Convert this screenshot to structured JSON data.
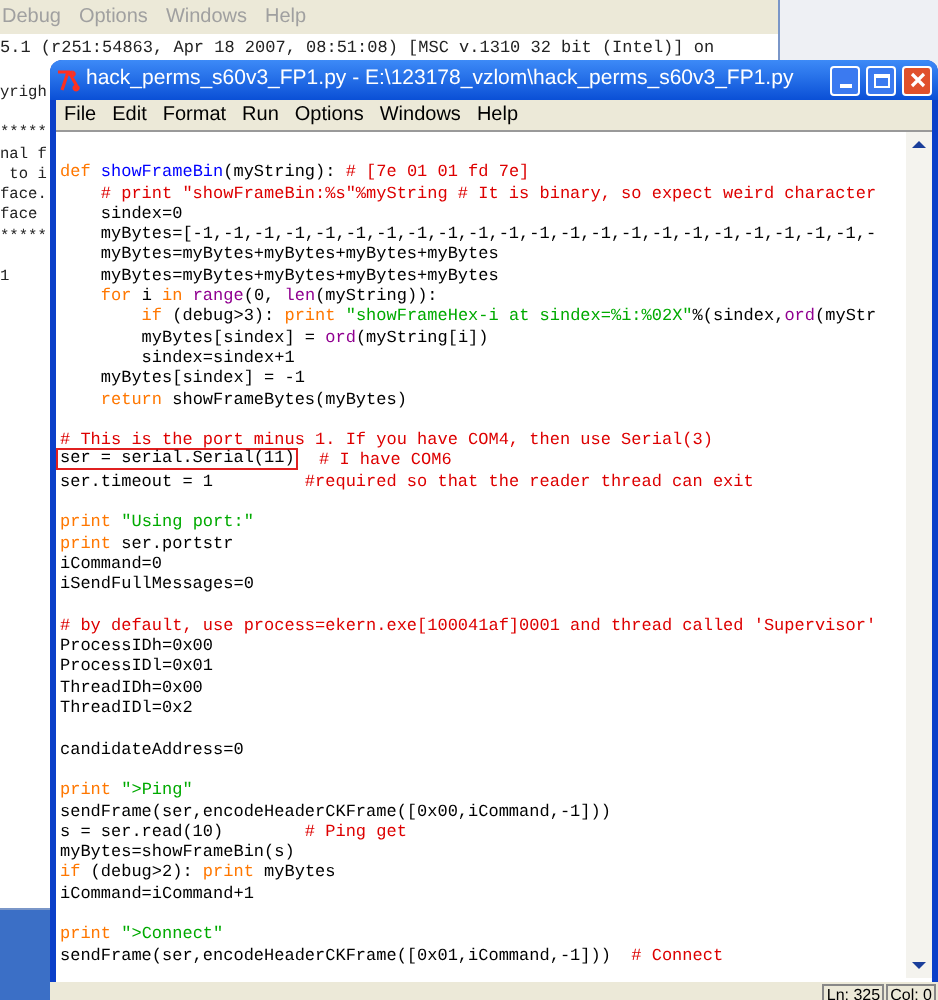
{
  "back_window": {
    "menu": [
      "Debug",
      "Options",
      "Windows",
      "Help"
    ],
    "header_line": "5.1 (r251:54863, Apr 18 2007, 08:51:08) [MSC v.1310 32 bit (Intel)] on",
    "lines": [
      "yrigh",
      "*****",
      "nal f",
      " to i",
      "face.",
      "face ",
      "*****",
      "1"
    ]
  },
  "window": {
    "title": "hack_perms_s60v3_FP1.py - E:\\123178_vzlom\\hack_perms_s60v3_FP1.py",
    "menu": [
      "File",
      "Edit",
      "Format",
      "Run",
      "Options",
      "Windows",
      "Help"
    ],
    "code": [
      {
        "kind": "blank"
      },
      {
        "kind": "code",
        "segments": [
          {
            "kind": "keyword",
            "text": "def "
          },
          {
            "kind": "definition",
            "text": "showFrameBin"
          },
          {
            "kind": "plain",
            "text": "(myString): "
          },
          {
            "kind": "comment",
            "text": "# [7e 01 01 fd 7e]"
          }
        ]
      },
      {
        "kind": "code",
        "segments": [
          {
            "kind": "comment",
            "text": "    # print \"showFrameBin:%s\"%myString # It is binary, so expect weird character"
          }
        ]
      },
      {
        "kind": "code",
        "segments": [
          {
            "kind": "plain",
            "text": "    sindex=0"
          }
        ]
      },
      {
        "kind": "code",
        "segments": [
          {
            "kind": "plain",
            "text": "    myBytes=[-1,-1,-1,-1,-1,-1,-1,-1,-1,-1,-1,-1,-1,-1,-1,-1,-1,-1,-1,-1,-1,-1,-"
          }
        ]
      },
      {
        "kind": "code",
        "segments": [
          {
            "kind": "plain",
            "text": "    myBytes=myBytes+myBytes+myBytes+myBytes"
          }
        ]
      },
      {
        "kind": "code",
        "segments": [
          {
            "kind": "plain",
            "text": "    myBytes=myBytes+myBytes+myBytes+myBytes"
          }
        ]
      },
      {
        "kind": "code",
        "segments": [
          {
            "kind": "keyword",
            "text": "    for"
          },
          {
            "kind": "plain",
            "text": " i "
          },
          {
            "kind": "keyword",
            "text": "in"
          },
          {
            "kind": "builtin",
            "text": " range"
          },
          {
            "kind": "plain",
            "text": "(0, "
          },
          {
            "kind": "builtin",
            "text": "len"
          },
          {
            "kind": "plain",
            "text": "(myString)):"
          }
        ]
      },
      {
        "kind": "code",
        "segments": [
          {
            "kind": "keyword",
            "text": "        if"
          },
          {
            "kind": "plain",
            "text": " (debug>3): "
          },
          {
            "kind": "keyword",
            "text": "print"
          },
          {
            "kind": "string",
            "text": " \"showFrameHex-i at sindex=%i:%02X\""
          },
          {
            "kind": "plain",
            "text": "%(sindex,"
          },
          {
            "kind": "builtin",
            "text": "ord"
          },
          {
            "kind": "plain",
            "text": "(myStr"
          }
        ]
      },
      {
        "kind": "code",
        "segments": [
          {
            "kind": "plain",
            "text": "        myBytes[sindex] = "
          },
          {
            "kind": "builtin",
            "text": "ord"
          },
          {
            "kind": "plain",
            "text": "(myString[i])"
          }
        ]
      },
      {
        "kind": "code",
        "segments": [
          {
            "kind": "plain",
            "text": "        sindex=sindex+1"
          }
        ]
      },
      {
        "kind": "code",
        "segments": [
          {
            "kind": "plain",
            "text": "    myBytes[sindex] = -1"
          }
        ]
      },
      {
        "kind": "code",
        "segments": [
          {
            "kind": "keyword",
            "text": "    return"
          },
          {
            "kind": "plain",
            "text": " showFrameBytes(myBytes)"
          }
        ]
      },
      {
        "kind": "blank"
      },
      {
        "kind": "code",
        "segments": [
          {
            "kind": "comment",
            "text": "# This is the port minus 1. If you have COM4, then use Serial(3)"
          }
        ]
      },
      {
        "kind": "code",
        "segments": [
          {
            "kind": "plain",
            "text": "ser = serial.Serial(11)",
            "boxed": true
          },
          {
            "kind": "comment",
            "text": "  # I have COM6"
          }
        ]
      },
      {
        "kind": "code",
        "segments": [
          {
            "kind": "plain",
            "text": "ser.timeout = 1         "
          },
          {
            "kind": "comment",
            "text": "#required so that the reader thread can exit"
          }
        ]
      },
      {
        "kind": "blank"
      },
      {
        "kind": "code",
        "segments": [
          {
            "kind": "keyword",
            "text": "print"
          },
          {
            "kind": "string",
            "text": " \"Using port:\""
          }
        ]
      },
      {
        "kind": "code",
        "segments": [
          {
            "kind": "keyword",
            "text": "print"
          },
          {
            "kind": "plain",
            "text": " ser.portstr"
          }
        ]
      },
      {
        "kind": "code",
        "segments": [
          {
            "kind": "plain",
            "text": "iCommand=0"
          }
        ]
      },
      {
        "kind": "code",
        "segments": [
          {
            "kind": "plain",
            "text": "iSendFullMessages=0"
          }
        ]
      },
      {
        "kind": "blank"
      },
      {
        "kind": "code",
        "segments": [
          {
            "kind": "comment",
            "text": "# by default, use process=ekern.exe[100041af]0001 and thread called 'Supervisor'"
          }
        ]
      },
      {
        "kind": "code",
        "segments": [
          {
            "kind": "plain",
            "text": "ProcessIDh=0x00"
          }
        ]
      },
      {
        "kind": "code",
        "segments": [
          {
            "kind": "plain",
            "text": "ProcessIDl=0x01"
          }
        ]
      },
      {
        "kind": "code",
        "segments": [
          {
            "kind": "plain",
            "text": "ThreadIDh=0x00"
          }
        ]
      },
      {
        "kind": "code",
        "segments": [
          {
            "kind": "plain",
            "text": "ThreadIDl=0x2"
          }
        ]
      },
      {
        "kind": "blank"
      },
      {
        "kind": "code",
        "segments": [
          {
            "kind": "plain",
            "text": "candidateAddress=0"
          }
        ]
      },
      {
        "kind": "blank"
      },
      {
        "kind": "code",
        "segments": [
          {
            "kind": "keyword",
            "text": "print"
          },
          {
            "kind": "string",
            "text": " \">Ping\""
          }
        ]
      },
      {
        "kind": "code",
        "segments": [
          {
            "kind": "plain",
            "text": "sendFrame(ser,encodeHeaderCKFrame([0x00,iCommand,-1]))"
          }
        ]
      },
      {
        "kind": "code",
        "segments": [
          {
            "kind": "plain",
            "text": "s = ser.read(10)        "
          },
          {
            "kind": "comment",
            "text": "# Ping get"
          }
        ]
      },
      {
        "kind": "code",
        "segments": [
          {
            "kind": "plain",
            "text": "myBytes=showFrameBin(s)"
          }
        ]
      },
      {
        "kind": "code",
        "segments": [
          {
            "kind": "keyword",
            "text": "if"
          },
          {
            "kind": "plain",
            "text": " (debug>2): "
          },
          {
            "kind": "keyword",
            "text": "print"
          },
          {
            "kind": "plain",
            "text": " myBytes"
          }
        ]
      },
      {
        "kind": "code",
        "segments": [
          {
            "kind": "plain",
            "text": "iCommand=iCommand+1"
          }
        ]
      },
      {
        "kind": "blank"
      },
      {
        "kind": "code",
        "segments": [
          {
            "kind": "keyword",
            "text": "print"
          },
          {
            "kind": "string",
            "text": " \">Connect\""
          }
        ]
      },
      {
        "kind": "code",
        "segments": [
          {
            "kind": "plain",
            "text": "sendFrame(ser,encodeHeaderCKFrame([0x01,iCommand,-1]))  "
          },
          {
            "kind": "comment",
            "text": "# Connect"
          }
        ]
      }
    ],
    "status": [
      "Ln: 325",
      "Col: 0"
    ]
  }
}
